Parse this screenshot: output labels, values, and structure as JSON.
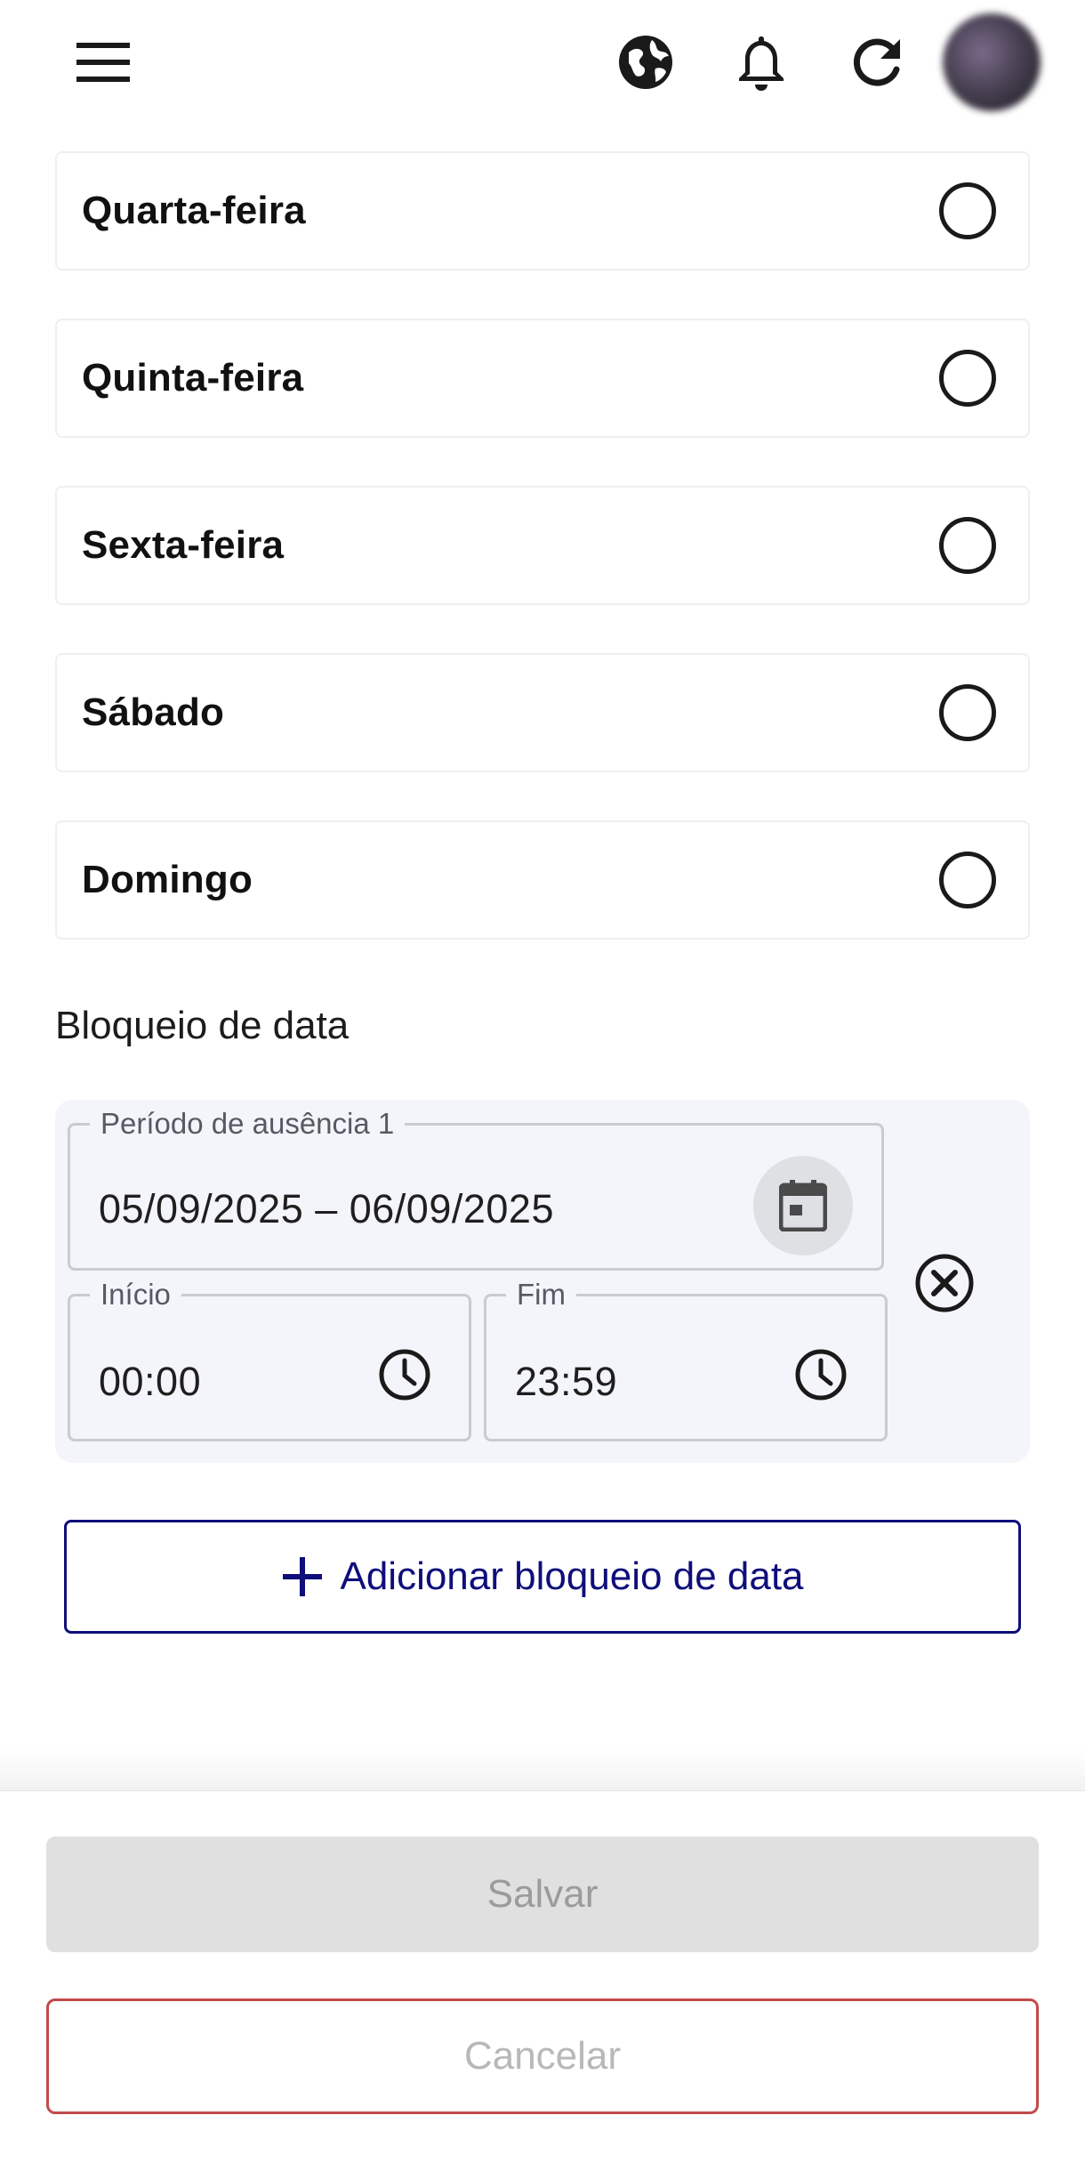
{
  "header": {
    "icons": [
      "menu-icon",
      "globe-icon",
      "bell-icon",
      "refresh-icon",
      "avatar"
    ]
  },
  "days": [
    {
      "label": "Quarta-feira",
      "selected": false
    },
    {
      "label": "Quinta-feira",
      "selected": false
    },
    {
      "label": "Sexta-feira",
      "selected": false
    },
    {
      "label": "Sábado",
      "selected": false
    },
    {
      "label": "Domingo",
      "selected": false
    }
  ],
  "date_block": {
    "title": "Bloqueio de data",
    "period": {
      "label": "Período de ausência 1",
      "value": "05/09/2025 – 06/09/2025"
    },
    "start": {
      "label": "Início",
      "value": "00:00"
    },
    "end": {
      "label": "Fim",
      "value": "23:59"
    },
    "add_label": "Adicionar bloqueio de data"
  },
  "actions": {
    "save_label": "Salvar",
    "cancel_label": "Cancelar"
  },
  "colors": {
    "accent": "#0f0e7a",
    "cancel_border": "#c24a4a",
    "panel_bg": "#f4f5fb",
    "disabled_bg": "#e0e0e0"
  }
}
